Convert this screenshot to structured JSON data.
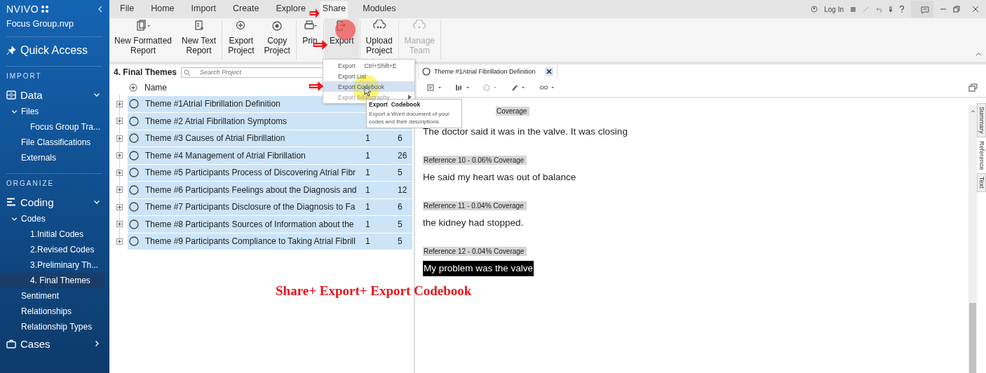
{
  "app": {
    "logo": "NVIVO",
    "project": "Focus Group.nvp",
    "login": "Log In"
  },
  "sidebar": {
    "quick_access": "Quick Access",
    "sections": [
      {
        "heading": "IMPORT",
        "groups": [
          {
            "label": "Data",
            "expanded": true,
            "items": [
              {
                "label": "Files",
                "expanded": true,
                "selected": false,
                "children": [
                  {
                    "label": "Focus Group Tra...",
                    "selected": false
                  }
                ]
              },
              {
                "label": "File Classifications",
                "selected": false
              },
              {
                "label": "Externals",
                "selected": false
              }
            ]
          }
        ]
      },
      {
        "heading": "ORGANIZE",
        "groups": [
          {
            "label": "Coding",
            "expanded": true,
            "items": [
              {
                "label": "Codes",
                "expanded": true,
                "selected": false,
                "children": [
                  {
                    "label": "1.Initial Codes",
                    "selected": false
                  },
                  {
                    "label": "2.Revised Codes",
                    "selected": false
                  },
                  {
                    "label": "3.Preliminary Th...",
                    "selected": false
                  },
                  {
                    "label": "4. Final Themes",
                    "selected": true
                  }
                ]
              },
              {
                "label": "Sentiment",
                "selected": false
              },
              {
                "label": "Relationships",
                "selected": false
              },
              {
                "label": "Relationship Types",
                "selected": false
              }
            ]
          },
          {
            "label": "Cases",
            "expanded": false
          }
        ]
      }
    ]
  },
  "tabs": [
    {
      "label": "File",
      "selected": false
    },
    {
      "label": "Home",
      "selected": false
    },
    {
      "label": "Import",
      "selected": false
    },
    {
      "label": "Create",
      "selected": false
    },
    {
      "label": "Explore",
      "selected": false
    },
    {
      "label": "Share",
      "selected": true
    },
    {
      "label": "Modules",
      "selected": false
    }
  ],
  "ribbon": [
    {
      "label": "New Formatted\nReport",
      "disabled": false,
      "selected": false
    },
    {
      "label": "New Text\nReport",
      "disabled": false,
      "selected": false
    },
    {
      "label": "Export\nProject",
      "disabled": false,
      "selected": false
    },
    {
      "label": "Copy\nProject",
      "disabled": false,
      "selected": false
    },
    {
      "label": "Prin",
      "disabled": false,
      "selected": false
    },
    {
      "label": "Export",
      "disabled": false,
      "selected": true
    },
    {
      "label": "Upload\nProject",
      "disabled": false,
      "selected": false
    },
    {
      "label": "Manage\nTeam",
      "disabled": true,
      "selected": false
    }
  ],
  "export_menu": [
    {
      "label": "Export",
      "shortcut": "Ctrl+Shift+E",
      "selected": false,
      "disabled": false
    },
    {
      "label": "Export List",
      "selected": false,
      "disabled": false
    },
    {
      "label": "Export Codebook",
      "selected": true,
      "disabled": false
    },
    {
      "label": "Export Bibliography",
      "selected": false,
      "disabled": true,
      "submenu": true
    }
  ],
  "tooltip": {
    "title": "Export  Codebook",
    "text": "Export a Word document of your codes and their descriptions."
  },
  "list_view": {
    "title": "4. Final Themes",
    "search": {
      "placeholder": "Search Project"
    },
    "columns": [
      "Name"
    ],
    "rows": [
      {
        "name": "Theme #1Atrial Fibrillation Definition",
        "selected": true
      },
      {
        "name": "Theme #2 Atrial Fibrillation Symptoms",
        "selected": true
      },
      {
        "name": "Theme #3 Causes of Atrial Fibrillation",
        "files": "1",
        "references": "6",
        "selected": true
      },
      {
        "name": "Theme #4 Management of Atrial Fibrillation",
        "files": "1",
        "references": "26",
        "selected": true
      },
      {
        "name": "Theme #5  Participants Process of Discovering Atrial Fibr",
        "files": "1",
        "references": "5",
        "selected": true
      },
      {
        "name": "Theme #6 Participants Feelings about the Diagnosis and",
        "files": "1",
        "references": "12",
        "selected": true
      },
      {
        "name": "Theme #7 Participants Disclosure of the Diagnosis to Fa",
        "files": "1",
        "references": "6",
        "selected": true
      },
      {
        "name": "Theme #8 Participants Sources of Information about the",
        "files": "1",
        "references": "5",
        "selected": true
      },
      {
        "name": "Theme #9 Participants Compliance to Taking Atrial Fibrill",
        "files": "1",
        "references": "5",
        "selected": true
      }
    ]
  },
  "document": {
    "tab": "Theme #1Atrial Fibrillation Definition",
    "side_tabs": [
      {
        "label": "Summary",
        "selected": false
      },
      {
        "label": "Reference",
        "selected": true
      },
      {
        "label": "Text",
        "selected": false
      }
    ],
    "blocks": [
      {
        "heading": "Coverage",
        "text": "The doctor said it was in the valve. It was closing",
        "highlighted": false
      },
      {
        "heading": "Reference 10 - 0.06% Coverage",
        "text": "He said my heart was out of balance",
        "highlighted": false
      },
      {
        "heading": "Reference 11 - 0.04% Coverage",
        "text": "the kidney had stopped.",
        "highlighted": false
      },
      {
        "heading": "Reference 12 - 0.04% Coverage",
        "text": "My problem was the valve",
        "highlighted": true
      }
    ]
  },
  "annotation": "Share+ Export+ Export Codebook"
}
